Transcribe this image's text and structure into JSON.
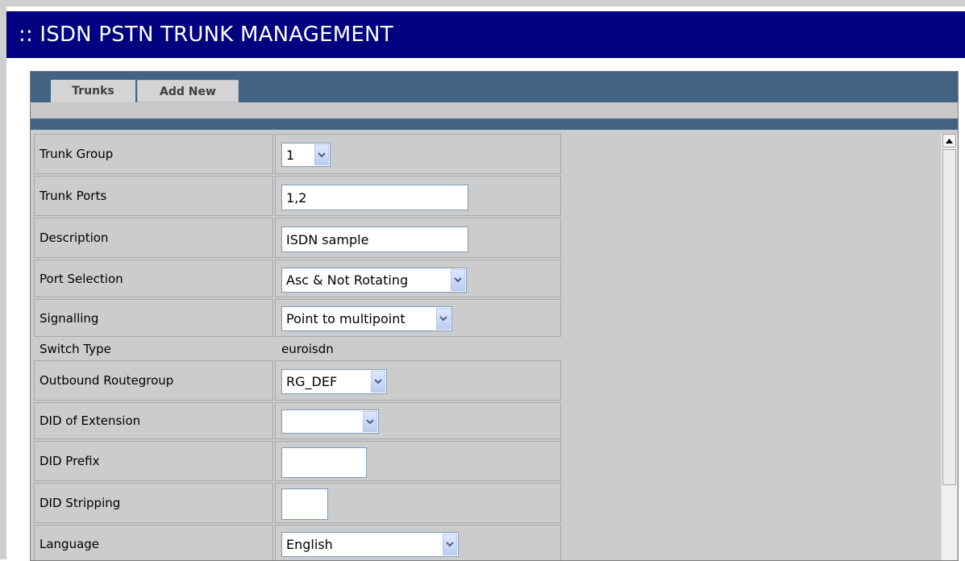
{
  "app": {
    "title": ":: ISDN PSTN TRUNK MANAGEMENT"
  },
  "tabs": [
    {
      "label": "Trunks"
    },
    {
      "label": "Add New"
    }
  ],
  "form": {
    "trunk_group": {
      "label": "Trunk Group",
      "value": "1"
    },
    "trunk_ports": {
      "label": "Trunk Ports",
      "value": "1,2"
    },
    "description": {
      "label": "Description",
      "value": "ISDN sample"
    },
    "port_selection": {
      "label": "Port Selection",
      "value": "Asc & Not Rotating"
    },
    "signalling": {
      "label": "Signalling",
      "value": "Point to multipoint"
    },
    "switch_type": {
      "label": "Switch Type",
      "value": "euroisdn"
    },
    "outbound_routegroup": {
      "label": "Outbound Routegroup",
      "value": "RG_DEF"
    },
    "did_of_extension": {
      "label": "DID of Extension",
      "value": ""
    },
    "did_prefix": {
      "label": "DID Prefix",
      "value": ""
    },
    "did_stripping": {
      "label": "DID Stripping",
      "value": ""
    },
    "language": {
      "label": "Language",
      "value": "English"
    }
  },
  "icons": {
    "dropdown_arrow": "chevron-down-icon",
    "scroll_up": "triangle-up-icon"
  },
  "colors": {
    "title_bar": "#000080",
    "tab_bar": "#436385",
    "content_bg": "#cccccc"
  }
}
